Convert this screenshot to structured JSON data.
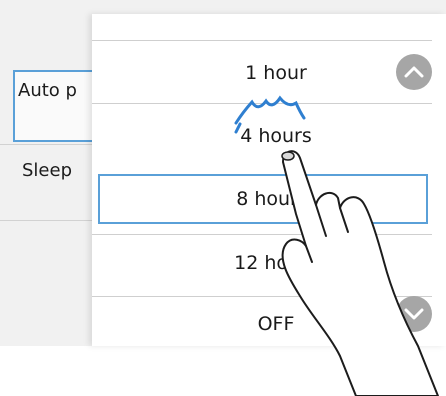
{
  "background_screen": {
    "items": [
      {
        "label": "Auto p",
        "selected": true
      },
      {
        "label": "Sleep",
        "selected": false
      }
    ]
  },
  "picker": {
    "options": [
      {
        "label": "1 hour",
        "selected": false
      },
      {
        "label": "4 hours",
        "selected": false
      },
      {
        "label": "8 hours",
        "selected": true
      },
      {
        "label": "12 hours",
        "selected": false
      },
      {
        "label": "OFF",
        "selected": false
      }
    ],
    "scroll_up_icon": "chevron-up-icon",
    "scroll_down_icon": "chevron-down-icon"
  },
  "overlay": {
    "hand_icon": "pointing-hand-icon",
    "gesture_icon": "flick-gesture-icon"
  },
  "colors": {
    "selection_border": "#5aa0d8",
    "scroll_button": "#a6a6a6",
    "panel_bg": "#ffffff",
    "screen_bg": "#f1f1f1",
    "gesture_stroke": "#2f7fd0"
  }
}
